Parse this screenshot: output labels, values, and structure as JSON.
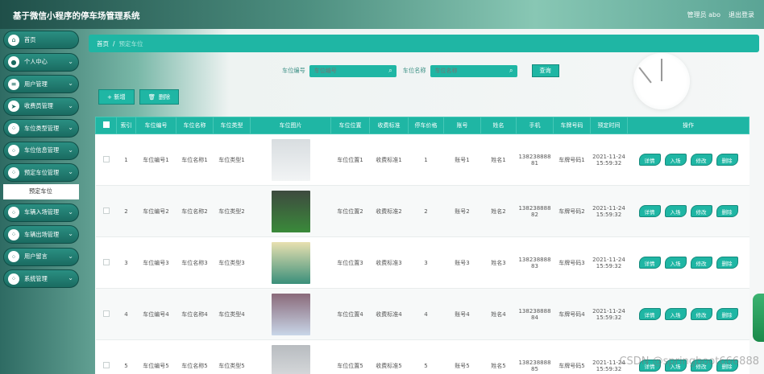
{
  "app": {
    "title": "基于微信小程序的停车场管理系统",
    "admin_label": "管理员 abo",
    "logout_label": "退出登录"
  },
  "sidebar": {
    "items": [
      {
        "label": "首页",
        "icon": "home-icon",
        "glyph": "⌂",
        "has_chevron": false
      },
      {
        "label": "个人中心",
        "icon": "person-icon",
        "glyph": "●",
        "has_chevron": true
      },
      {
        "label": "用户管理",
        "icon": "list-icon",
        "glyph": "≡",
        "has_chevron": true
      },
      {
        "label": "收费员管理",
        "icon": "send-icon",
        "glyph": "➤",
        "has_chevron": true
      },
      {
        "label": "车位类型管理",
        "icon": "grid-icon",
        "glyph": "⁘",
        "has_chevron": true
      },
      {
        "label": "车位信息管理",
        "icon": "grid-icon",
        "glyph": "⁘",
        "has_chevron": true
      },
      {
        "label": "预定车位管理",
        "icon": "grid-icon",
        "glyph": "⁘",
        "has_chevron": true
      },
      {
        "label": "车辆入场管理",
        "icon": "grid-icon",
        "glyph": "⁘",
        "has_chevron": true
      },
      {
        "label": "车辆出场管理",
        "icon": "grid-icon",
        "glyph": "⁘",
        "has_chevron": true
      },
      {
        "label": "用户留言",
        "icon": "grid-icon",
        "glyph": "⁘",
        "has_chevron": true
      },
      {
        "label": "系统管理",
        "icon": "grid-icon",
        "glyph": "⁘",
        "has_chevron": true
      }
    ],
    "sub_item": "预定车位"
  },
  "breadcrumb": {
    "home": "首页",
    "separator": "/",
    "current": "预定车位"
  },
  "search": {
    "field1_label": "车位编号",
    "field1_placeholder": "车位编号",
    "field2_label": "车位名称",
    "field2_placeholder": "车位名称",
    "query_label": "查询"
  },
  "actions": {
    "add_label": "+ 新增",
    "delete_label": "删除"
  },
  "table": {
    "headers": [
      "",
      "索引",
      "车位编号",
      "车位名称",
      "车位类型",
      "车位图片",
      "车位位置",
      "收费标准",
      "停车价格",
      "账号",
      "姓名",
      "手机",
      "车牌号码",
      "预定时间",
      "操作"
    ],
    "rows": [
      {
        "idx": "1",
        "code": "车位编号1",
        "name": "车位名称1",
        "type": "车位类型1",
        "loc": "车位位置1",
        "fee": "收费标准1",
        "price": "1",
        "account": "账号1",
        "person": "姓名1",
        "phone": "13823888881",
        "plate": "车牌号码1",
        "time": "2021-11-24 15:59:32",
        "img_color": [
          "#d8dde0",
          "#f2f4f5"
        ]
      },
      {
        "idx": "2",
        "code": "车位编号2",
        "name": "车位名称2",
        "type": "车位类型2",
        "loc": "车位位置2",
        "fee": "收费标准2",
        "price": "2",
        "account": "账号2",
        "person": "姓名2",
        "phone": "13823888882",
        "plate": "车牌号码2",
        "time": "2021-11-24 15:59:32",
        "img_color": [
          "#3e4a3f",
          "#3a8a3a"
        ]
      },
      {
        "idx": "3",
        "code": "车位编号3",
        "name": "车位名称3",
        "type": "车位类型3",
        "loc": "车位位置3",
        "fee": "收费标准3",
        "price": "3",
        "account": "账号3",
        "person": "姓名3",
        "phone": "13823888883",
        "plate": "车牌号码3",
        "time": "2021-11-24 15:59:32",
        "img_color": [
          "#e8e0b0",
          "#3a8f7a"
        ]
      },
      {
        "idx": "4",
        "code": "车位编号4",
        "name": "车位名称4",
        "type": "车位类型4",
        "loc": "车位位置4",
        "fee": "收费标准4",
        "price": "4",
        "account": "账号4",
        "person": "姓名4",
        "phone": "13823888884",
        "plate": "车牌号码4",
        "time": "2021-11-24 15:59:32",
        "img_color": [
          "#8a6a7a",
          "#c8d6e8"
        ]
      },
      {
        "idx": "5",
        "code": "车位编号5",
        "name": "车位名称5",
        "type": "车位类型5",
        "loc": "车位位置5",
        "fee": "收费标准5",
        "price": "5",
        "account": "账号5",
        "person": "姓名5",
        "phone": "13823888885",
        "plate": "车牌号码5",
        "time": "2021-11-24 15:59:32",
        "img_color": [
          "#b8bcc0",
          "#e0e2e4"
        ]
      }
    ],
    "op_labels": [
      "详情",
      "入场",
      "修改",
      "删除"
    ]
  },
  "watermark": "CSDN @springboot666888",
  "colors": {
    "accent": "#1fb6a4",
    "sidebar": "#1a6b61"
  }
}
